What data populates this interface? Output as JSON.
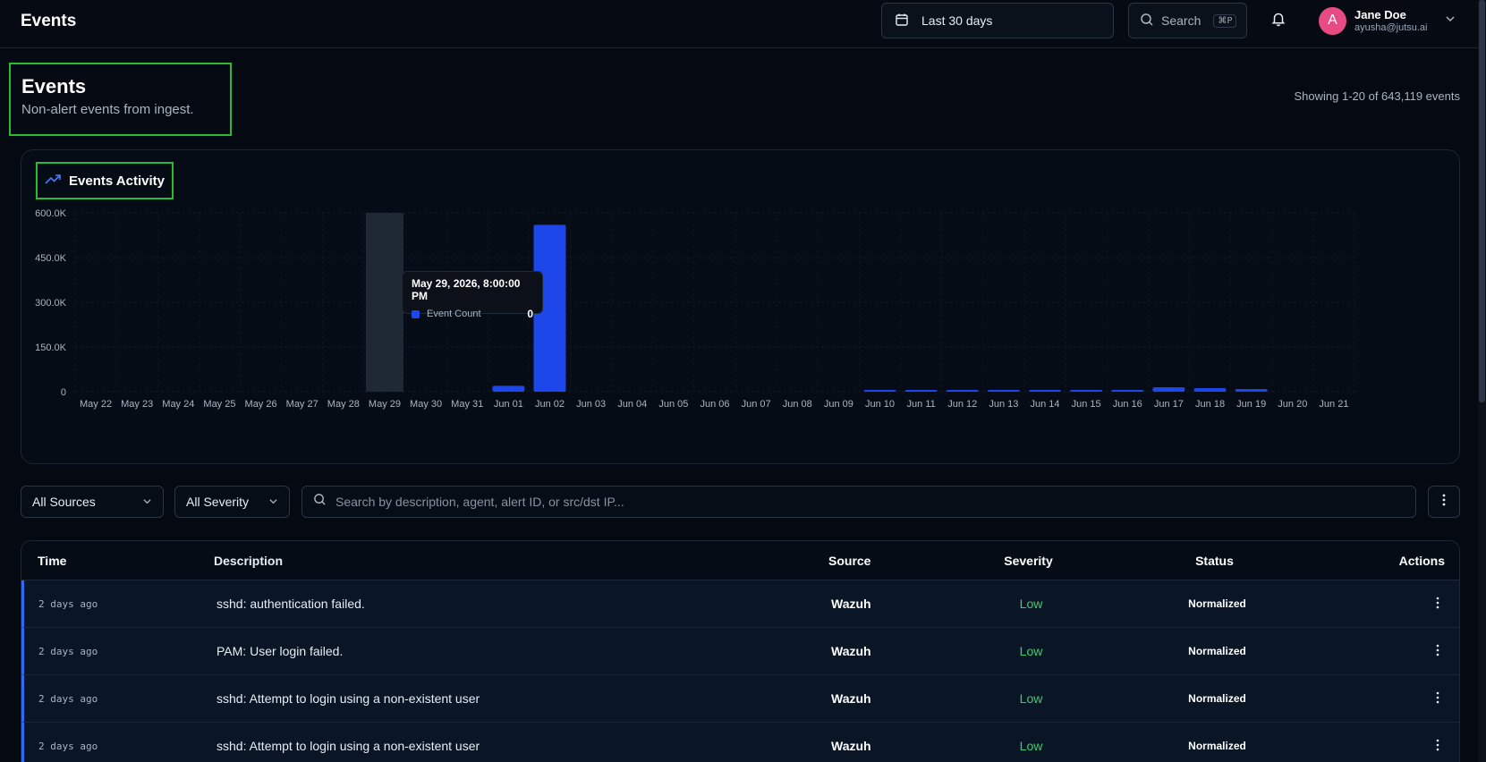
{
  "topbar": {
    "title": "Events",
    "date_range": "Last 30 days",
    "search_label": "Search",
    "search_shortcut": "⌘P",
    "user": {
      "initial": "A",
      "name": "Jane Doe",
      "email": "ayusha@jutsu.ai",
      "avatar_color": "#e84b83"
    }
  },
  "header": {
    "title": "Events",
    "subtitle": "Non-alert events from ingest.",
    "showing": "Showing 1-20 of 643,119 events"
  },
  "chart": {
    "title": "Events Activity",
    "tooltip": {
      "title": "May 29, 2026, 8:00:00 PM",
      "series": "Event Count",
      "value": "0"
    }
  },
  "chart_data": {
    "type": "bar",
    "title": "Events Activity",
    "categories": [
      "May 22",
      "May 23",
      "May 24",
      "May 25",
      "May 26",
      "May 27",
      "May 28",
      "May 29",
      "May 30",
      "May 31",
      "Jun 01",
      "Jun 02",
      "Jun 03",
      "Jun 04",
      "Jun 05",
      "Jun 06",
      "Jun 07",
      "Jun 08",
      "Jun 09",
      "Jun 10",
      "Jun 11",
      "Jun 12",
      "Jun 13",
      "Jun 14",
      "Jun 15",
      "Jun 16",
      "Jun 17",
      "Jun 18",
      "Jun 19",
      "Jun 20",
      "Jun 21"
    ],
    "series": [
      {
        "name": "Event Count",
        "values": [
          0,
          0,
          0,
          0,
          0,
          0,
          0,
          0,
          0,
          0,
          20000,
          560000,
          0,
          0,
          0,
          0,
          0,
          0,
          0,
          2000,
          5000,
          3000,
          2500,
          2000,
          2000,
          4000,
          15000,
          12000,
          9000,
          0,
          0
        ]
      }
    ],
    "yticks": [
      "0",
      "150.0K",
      "300.0K",
      "450.0K",
      "600.0K"
    ],
    "ylim": [
      0,
      600000
    ],
    "highlight_category": "May 29",
    "bar_color": "#1d47ea"
  },
  "filters": {
    "source": "All Sources",
    "severity": "All Severity",
    "search_placeholder": "Search by description, agent, alert ID, or src/dst IP..."
  },
  "table": {
    "headers": {
      "time": "Time",
      "description": "Description",
      "source": "Source",
      "severity": "Severity",
      "status": "Status",
      "actions": "Actions"
    },
    "rows": [
      {
        "time": "2 days ago",
        "description": "sshd: authentication failed.",
        "source": "Wazuh",
        "severity": "Low",
        "status": "Normalized"
      },
      {
        "time": "2 days ago",
        "description": "PAM: User login failed.",
        "source": "Wazuh",
        "severity": "Low",
        "status": "Normalized"
      },
      {
        "time": "2 days ago",
        "description": "sshd: Attempt to login using a non-existent user",
        "source": "Wazuh",
        "severity": "Low",
        "status": "Normalized"
      },
      {
        "time": "2 days ago",
        "description": "sshd: Attempt to login using a non-existent user",
        "source": "Wazuh",
        "severity": "Low",
        "status": "Normalized"
      }
    ]
  }
}
